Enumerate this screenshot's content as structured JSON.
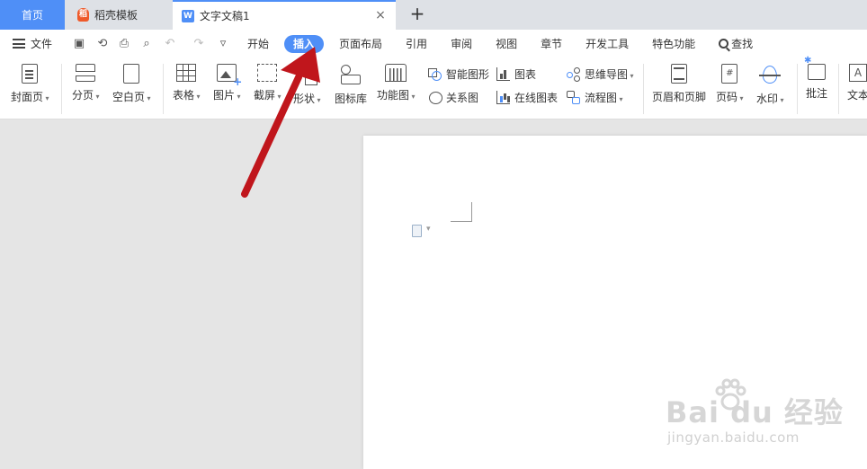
{
  "tabs": {
    "home": "首页",
    "daoke": "稻壳模板",
    "doc": "文字文稿1",
    "close_symbol": "×",
    "add_symbol": "+"
  },
  "menu": {
    "file": "文件",
    "tabs": [
      "开始",
      "插入",
      "页面布局",
      "引用",
      "审阅",
      "视图",
      "章节",
      "开发工具",
      "特色功能"
    ],
    "active_index": 1,
    "search": "查找"
  },
  "ribbon": {
    "cover": "封面页",
    "page_break": "分页",
    "blank_page": "空白页",
    "table": "表格",
    "picture": "图片",
    "screenshot": "截屏",
    "shape": "形状",
    "icon_library": "图标库",
    "function_chart": "功能图",
    "smart_graphic": "智能图形",
    "relation": "关系图",
    "chart": "图表",
    "online_chart": "在线图表",
    "mind_map": "思维导图",
    "flowchart": "流程图",
    "header_footer": "页眉和页脚",
    "page_number": "页码",
    "watermark": "水印",
    "comment": "批注",
    "textbox": "文本",
    "page_number_symbol": "#",
    "textbox_symbol": "A"
  },
  "watermark": {
    "main": "Bai du 经验",
    "sub": "jingyan.baidu.com"
  },
  "colors": {
    "accent": "#4f8ff7",
    "arrow": "#c0161c",
    "tab_bar": "#dee1e6",
    "canvas": "#e5e5e5"
  },
  "icons": {
    "daoke_logo": "稻",
    "doc_logo": "W"
  }
}
